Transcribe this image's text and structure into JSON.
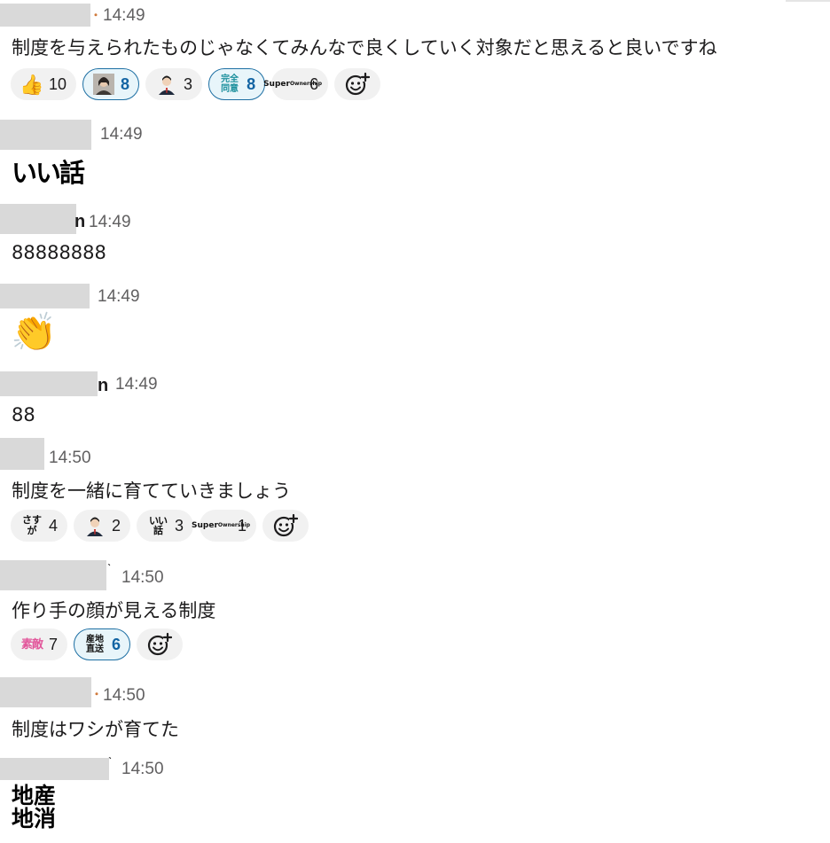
{
  "messages": [
    {
      "time": "14:49",
      "text": "制度を与えられたものじゃなくてみんなで良くしていく対象だと思えると良いですね",
      "reactions": [
        {
          "emoji": "thumbs-up",
          "count": "10",
          "active": false
        },
        {
          "emoji": "avatar-woman",
          "count": "8",
          "active": true
        },
        {
          "emoji": "avatar-man",
          "count": "3",
          "active": false
        },
        {
          "emoji": "完全同意",
          "count": "8",
          "active": true
        },
        {
          "emoji": "Super Ownership",
          "count": "6",
          "active": false
        }
      ]
    },
    {
      "time": "14:49",
      "text": "いい話"
    },
    {
      "time": "14:49",
      "name_tail": "n",
      "text": "88888888"
    },
    {
      "time": "14:49",
      "emoji": "clapping-hands"
    },
    {
      "time": "14:49",
      "name_tail": "n",
      "text": "88"
    },
    {
      "time": "14:50",
      "text": "制度を一緒に育てていきましょう",
      "reactions": [
        {
          "emoji": "さすが",
          "count": "4",
          "active": false
        },
        {
          "emoji": "avatar-man",
          "count": "2",
          "active": false
        },
        {
          "emoji": "いい話",
          "count": "3",
          "active": false
        },
        {
          "emoji": "Super Ownership",
          "count": "1",
          "active": false
        }
      ]
    },
    {
      "time": "14:50",
      "text": "作り手の顔が見える制度",
      "reactions": [
        {
          "emoji": "素敵",
          "count": "7",
          "active": false
        },
        {
          "emoji": "産地直送",
          "count": "6",
          "active": true
        }
      ]
    },
    {
      "time": "14:50",
      "text": "制度はワシが育てた"
    },
    {
      "time": "14:50",
      "text_line1": "地産",
      "text_line2": "地消"
    }
  ],
  "colors": {
    "redaction": "#d9d9d9",
    "active_border": "#1d6fa3",
    "active_bg": "#e8f5fa",
    "reaction_bg": "#f1f1f1",
    "timestamp": "#616061"
  }
}
